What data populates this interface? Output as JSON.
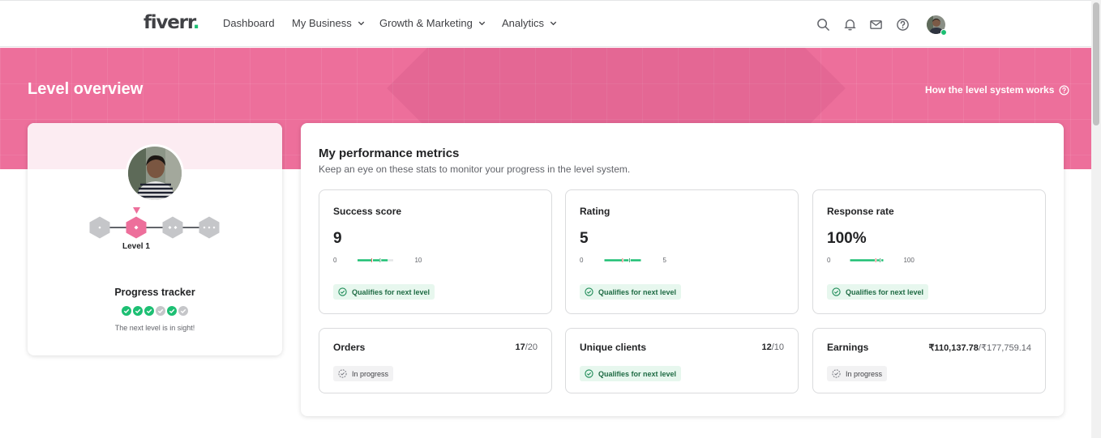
{
  "nav": {
    "logo": "fiverr",
    "logo_dot": ".",
    "items": [
      {
        "label": "Dashboard",
        "has_dropdown": false
      },
      {
        "label": "My Business",
        "has_dropdown": true
      },
      {
        "label": "Growth & Marketing",
        "has_dropdown": true
      },
      {
        "label": "Analytics",
        "has_dropdown": true
      }
    ],
    "icons": [
      "search-icon",
      "bell-icon",
      "mail-icon",
      "help-icon"
    ]
  },
  "header": {
    "title": "Level overview",
    "help_link": "How the level system works"
  },
  "profile": {
    "level_label": "Level 1",
    "current_level_index": 1,
    "tracker_title": "Progress tracker",
    "tracker_steps": [
      true,
      true,
      true,
      false,
      true,
      false
    ],
    "tracker_note": "The next level is in sight!"
  },
  "metrics": {
    "title": "My performance metrics",
    "subtitle": "Keep an eye on these stats to monitor your progress in the level system.",
    "scored": [
      {
        "label": "Success score",
        "value": "9",
        "min": "0",
        "max": "10",
        "status": "Qualifies for next level"
      },
      {
        "label": "Rating",
        "value": "5",
        "min": "0",
        "max": "5",
        "status": "Qualifies for next level"
      },
      {
        "label": "Response rate",
        "value": "100%",
        "min": "0",
        "max": "100",
        "status": "Qualifies for next level"
      }
    ],
    "counted": [
      {
        "label": "Orders",
        "current": "17",
        "target": "/20",
        "status": "In progress",
        "qualified": false
      },
      {
        "label": "Unique clients",
        "current": "12",
        "target": "/10",
        "status": "Qualifies for next level",
        "qualified": true
      },
      {
        "label": "Earnings",
        "current": "₹110,137.78",
        "target": "/₹177,759.14",
        "status": "In progress",
        "qualified": false
      }
    ]
  },
  "colors": {
    "brand_pink": "#ed6f9b",
    "success_green": "#1dbf73",
    "marker_red": "#e0403b",
    "text_dark": "#222325"
  }
}
